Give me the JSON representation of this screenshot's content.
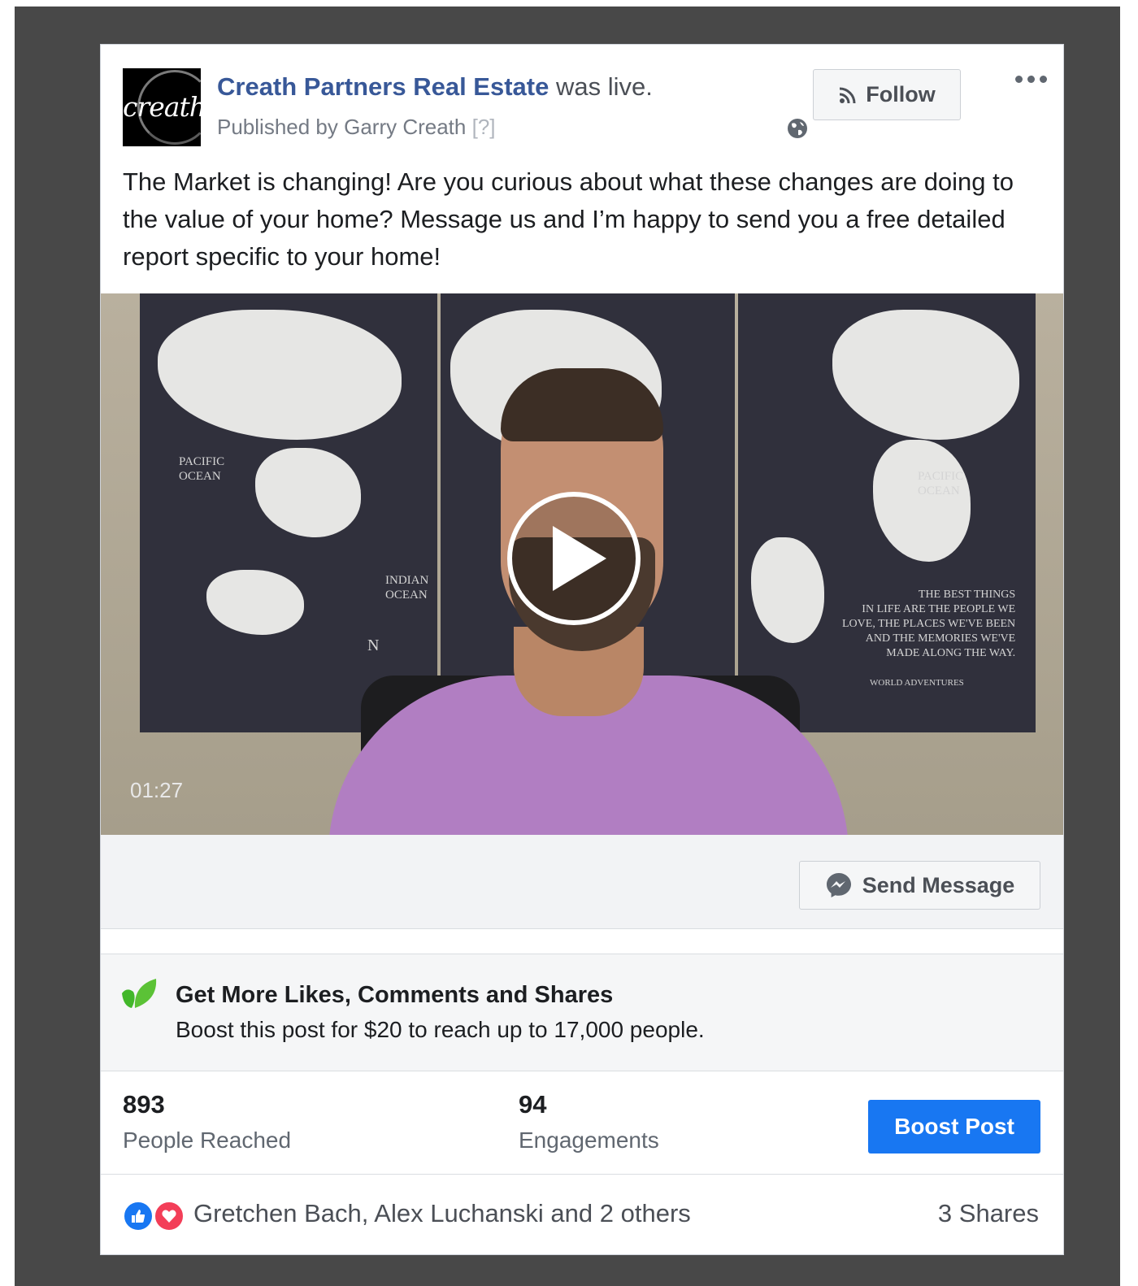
{
  "post": {
    "page_name": "Creath Partners Real Estate",
    "action_text": "was live.",
    "published_by": "Published by Garry Creath",
    "published_help": "[?]",
    "logo_text": "creath",
    "follow_label": "Follow",
    "body": "The Market is changing! Are you curious about what these changes are doing to the value of your home? Message us and I’m happy to send you a free detailed report specific to your home!"
  },
  "video": {
    "duration": "01:27",
    "map_labels": {
      "pacific_left": "PACIFIC\nOCEAN",
      "pacific_right": "PACIFIC\nOCEAN",
      "indian": "INDIAN\nOCEAN",
      "compass_n": "N",
      "quote": "THE BEST THINGS\nIN LIFE ARE THE PEOPLE WE\nLOVE, THE PLACES WE'VE BEEN\nAND THE MEMORIES WE'VE\nMADE ALONG THE WAY.",
      "brand": "WORLD ADVENTURES"
    }
  },
  "message_bar": {
    "send_label": "Send Message"
  },
  "promo": {
    "title": "Get More Likes, Comments and Shares",
    "description": "Boost this post for $20 to reach up to 17,000 people."
  },
  "stats": {
    "reached_value": "893",
    "reached_label": "People Reached",
    "engagements_value": "94",
    "engagements_label": "Engagements",
    "boost_label": "Boost Post"
  },
  "reactions": {
    "text": "Gretchen Bach, Alex Luchanski and 2 others",
    "shares": "3 Shares"
  },
  "colors": {
    "link_blue": "#385898",
    "boost_blue": "#1877f2",
    "like_blue": "#1877f2",
    "love_red": "#f33e58",
    "leaf_green": "#42b72a"
  }
}
